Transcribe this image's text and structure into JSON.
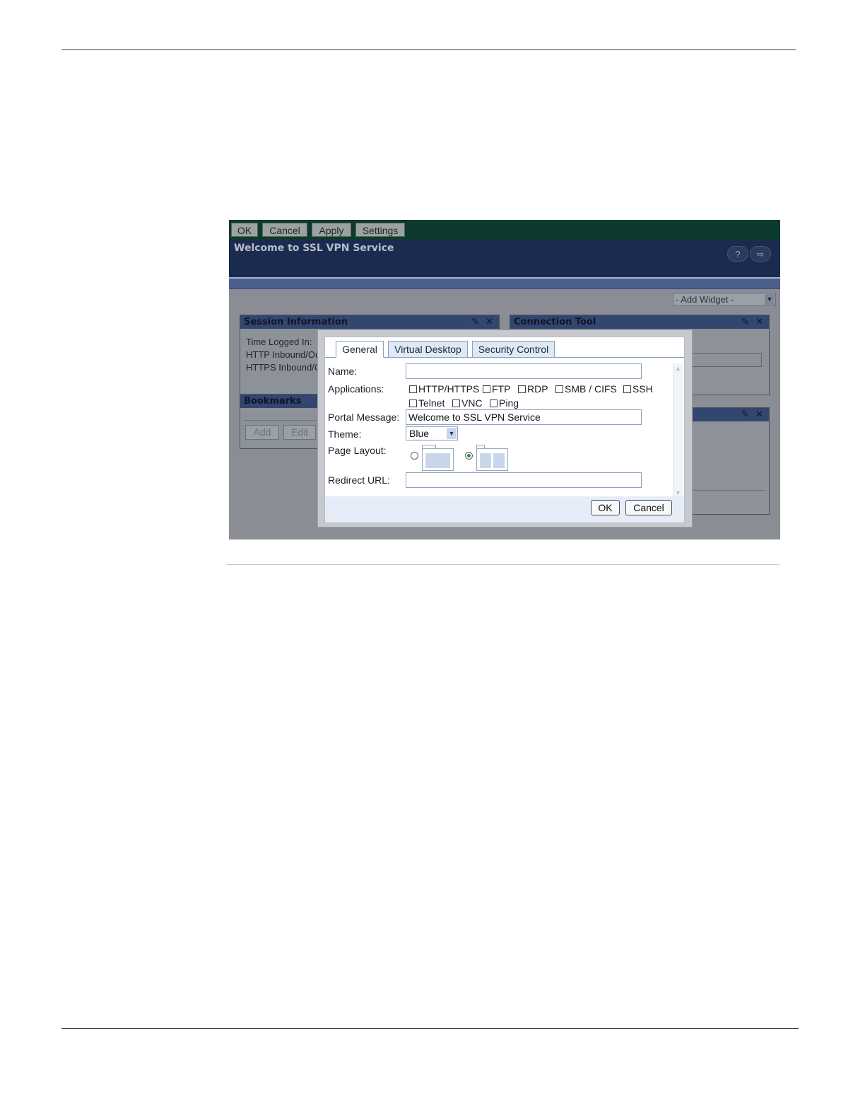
{
  "toolbar": {
    "ok": "OK",
    "cancel": "Cancel",
    "apply": "Apply",
    "settings": "Settings"
  },
  "banner": {
    "title": "Welcome to SSL VPN Service",
    "help": "?",
    "logout": "⇨"
  },
  "add_widget": {
    "label": "- Add Widget -"
  },
  "session_panel": {
    "title": "Session Information",
    "lines": [
      "Time Logged In:",
      "HTTP Inbound/Ou",
      "HTTPS Inbound/C"
    ]
  },
  "connection_panel": {
    "title": "Connection Tool"
  },
  "bookmarks_panel": {
    "title": "Bookmarks",
    "add": "Add",
    "edit": "Edit"
  },
  "panel_icons": {
    "edit": "✎",
    "close": "✕"
  },
  "dialog": {
    "tabs": [
      "General",
      "Virtual Desktop",
      "Security Control"
    ],
    "active_tab": "General",
    "labels": {
      "name": "Name:",
      "applications": "Applications:",
      "portal_message": "Portal Message:",
      "theme": "Theme:",
      "page_layout": "Page Layout:",
      "redirect_url": "Redirect URL:"
    },
    "name_value": "",
    "applications_row1": [
      "HTTP/HTTPS",
      "FTP",
      "RDP",
      "SMB / CIFS",
      "SSH"
    ],
    "applications_row2": [
      "Telnet",
      "VNC",
      "Ping"
    ],
    "portal_message_value": "Welcome to SSL VPN Service",
    "theme_value": "Blue",
    "page_layout_selected": "two-column",
    "redirect_url_value": "",
    "ok": "OK",
    "cancel": "Cancel"
  }
}
